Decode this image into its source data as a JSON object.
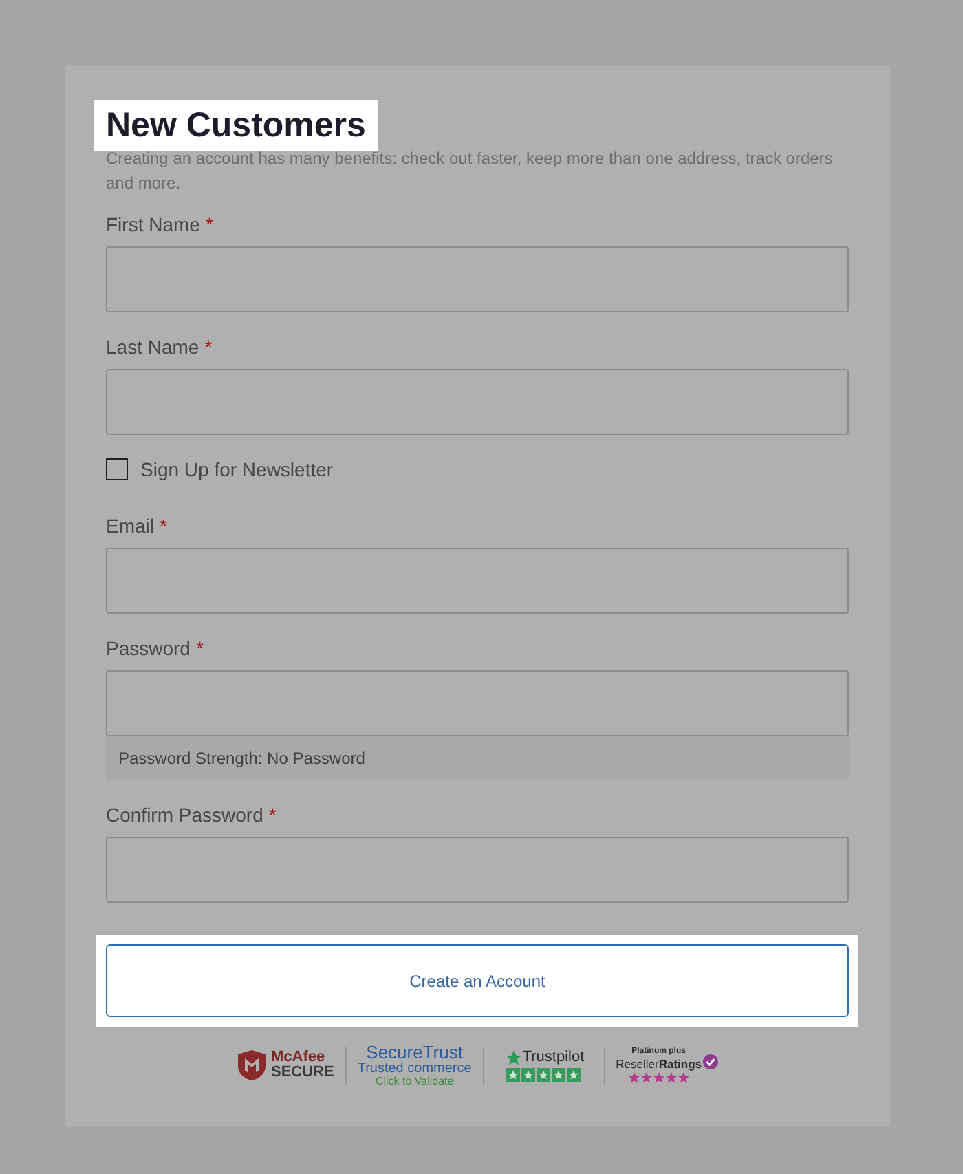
{
  "heading": {
    "text": "New Customers",
    "highlighted": true
  },
  "intro": "Creating an account has many benefits: check out faster, keep more than one address, track orders and more.",
  "form": {
    "fields": [
      {
        "kind": "text",
        "label": "First Name",
        "required_mark": "*"
      },
      {
        "kind": "text",
        "label": "Last Name",
        "required_mark": "*"
      },
      {
        "kind": "checkbox",
        "label": "Sign Up for Newsletter",
        "checked": false
      },
      {
        "kind": "email",
        "label": "Email",
        "required_mark": "*"
      },
      {
        "kind": "password",
        "label": "Password",
        "required_mark": "*",
        "strength_text": "Password Strength: No Password"
      },
      {
        "kind": "password",
        "label": "Confirm Password",
        "required_mark": "*"
      }
    ]
  },
  "submit_button": {
    "label": "Create an Account",
    "highlighted": true
  },
  "trust_badges": [
    {
      "kind": "mcafee",
      "title": "McAfee",
      "subtitle": "SECURE"
    },
    {
      "kind": "securetrust",
      "title": "SecureTrust",
      "subtitle": "Trusted commerce",
      "link": "Click to Validate"
    },
    {
      "kind": "trustpilot",
      "title": "Trustpilot",
      "stars": 5
    },
    {
      "kind": "resellerratings",
      "tier": "Platinum plus",
      "title": "Reseller**Ratings**",
      "stars": 5
    }
  ]
}
